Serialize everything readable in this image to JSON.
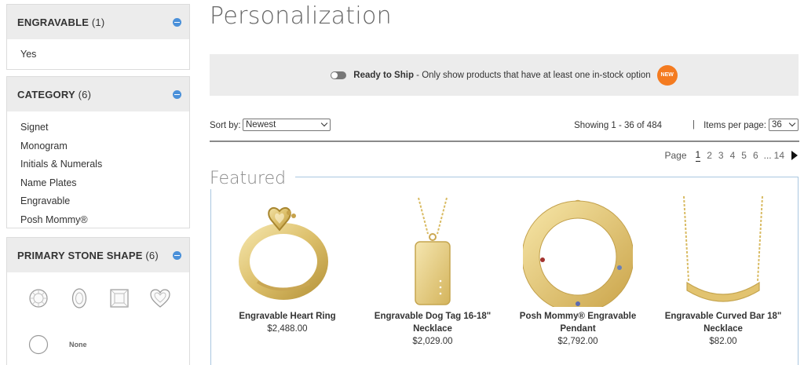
{
  "sidebar": {
    "engravable": {
      "title": "ENGRAVABLE",
      "count": "(1)",
      "items": [
        "Yes"
      ]
    },
    "category": {
      "title": "CATEGORY",
      "count": "(6)",
      "items": [
        "Signet",
        "Monogram",
        "Initials & Numerals",
        "Name Plates",
        "Engravable",
        "Posh Mommy®"
      ]
    },
    "stone_shape": {
      "title": "PRIMARY STONE SHAPE",
      "count": "(6)",
      "none_label": "None"
    }
  },
  "main": {
    "title": "Personalization",
    "ready_to_ship": {
      "bold": "Ready to Ship",
      "rest": " - Only show products that have at least one in-stock option",
      "badge": "NEW"
    },
    "sort": {
      "label": "Sort by:",
      "selected": "Newest"
    },
    "showing": "Showing 1 - 36 of 484",
    "separator": "|",
    "items_per_page": {
      "label": "Items per page:",
      "selected": "36"
    },
    "pager": {
      "label": "Page",
      "pages": [
        "1",
        "2",
        "3",
        "4",
        "5",
        "6"
      ],
      "ellipsis": "...",
      "last": "14"
    },
    "featured": {
      "label": "Featured",
      "products": [
        {
          "name": "Engravable Heart Ring",
          "price": "$2,488.00"
        },
        {
          "name": "Engravable Dog Tag 16-18\" Necklace",
          "price": "$2,029.00"
        },
        {
          "name": "Posh Mommy® Engravable Pendant",
          "price": "$2,792.00"
        },
        {
          "name": "Engravable Curved Bar 18\" Necklace",
          "price": "$82.00"
        }
      ]
    }
  },
  "colors": {
    "gold": "#e3c77a",
    "accent_blue": "#4a90d9",
    "badge_orange": "#f47b20"
  }
}
